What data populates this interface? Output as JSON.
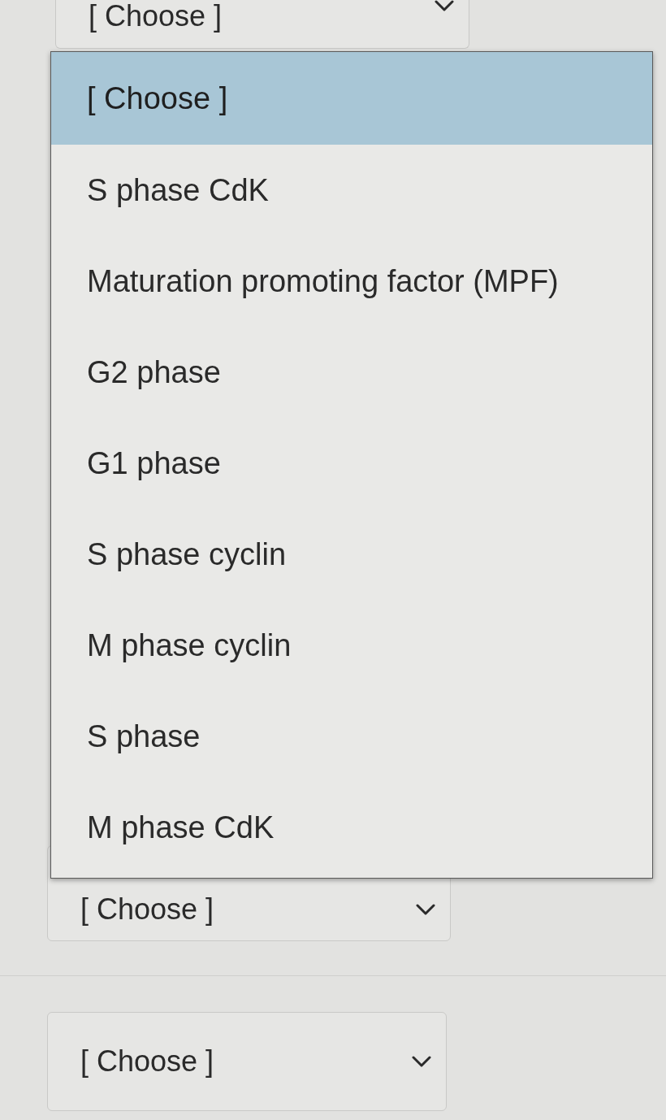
{
  "top_select": {
    "value": "[ Choose ]"
  },
  "dropdown": {
    "options": [
      {
        "label": "[ Choose ]",
        "selected": true
      },
      {
        "label": "S phase CdK",
        "selected": false
      },
      {
        "label": "Maturation promoting factor (MPF)",
        "selected": false
      },
      {
        "label": "G2 phase",
        "selected": false
      },
      {
        "label": "G1 phase",
        "selected": false
      },
      {
        "label": "S phase cyclin",
        "selected": false
      },
      {
        "label": "M phase cyclin",
        "selected": false
      },
      {
        "label": "S phase",
        "selected": false
      },
      {
        "label": "M phase CdK",
        "selected": false
      }
    ]
  },
  "selects": [
    {
      "value": "[ Choose ]"
    },
    {
      "value": "[ Choose ]"
    }
  ]
}
